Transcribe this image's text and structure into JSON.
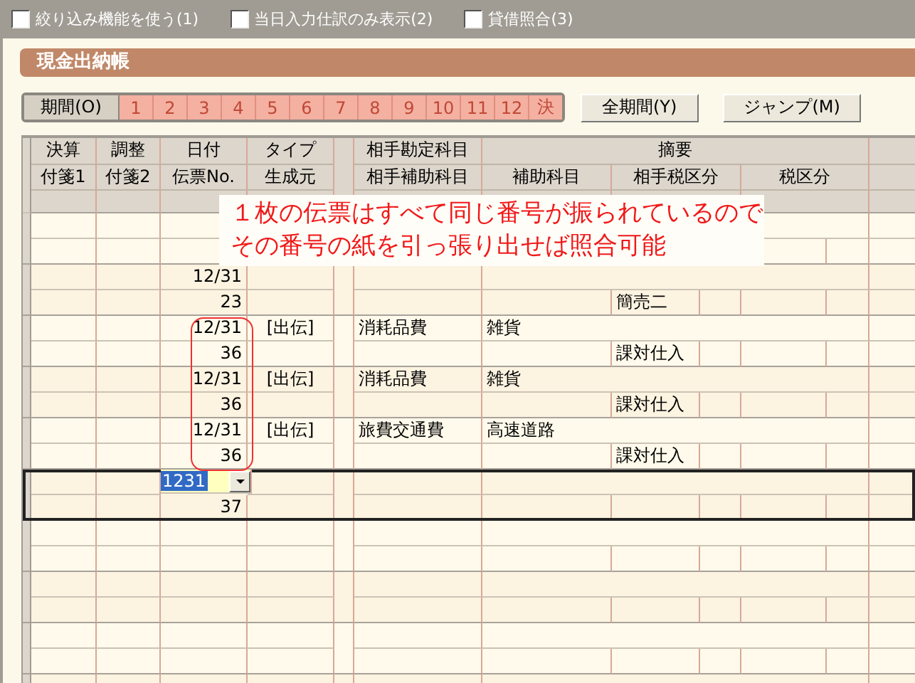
{
  "options": [
    {
      "label": "絞り込み機能を使う(1)",
      "checked": false
    },
    {
      "label": "当日入力仕訳のみ表示(2)",
      "checked": false
    },
    {
      "label": "貸借照合(3)",
      "checked": false
    }
  ],
  "ledger": {
    "title": "現金出納帳"
  },
  "period_bar": {
    "label": "期間(O)",
    "periods": [
      "1",
      "2",
      "3",
      "4",
      "5",
      "6",
      "7",
      "8",
      "9",
      "10",
      "11",
      "12",
      "決"
    ],
    "buttons": [
      "全期間(Y)",
      "ジャンプ(M)"
    ]
  },
  "table": {
    "header_top": [
      "決算",
      "調整",
      "日付",
      "タイプ",
      "相手勘定科目",
      "摘要"
    ],
    "header_bottom": [
      "付箋1",
      "付箋2",
      "伝票No.",
      "生成元",
      "相手補助科目",
      "補助科目",
      "相手税区分",
      "税区分"
    ],
    "entries": [
      {
        "kind": "entry",
        "selected": false
      },
      {
        "kind": "entry",
        "selected": false,
        "date": "12/31",
        "voucher_no": "23",
        "counter_tax": "簡売二"
      },
      {
        "kind": "entry",
        "selected": false,
        "date": "12/31",
        "type": "[出伝]",
        "account": "消耗品費",
        "memo": "雑貨",
        "voucher_no": "36",
        "counter_tax": "課対仕入"
      },
      {
        "kind": "entry",
        "selected": false,
        "date": "12/31",
        "type": "[出伝]",
        "account": "消耗品費",
        "memo": "雑貨",
        "voucher_no": "36",
        "counter_tax": "課対仕入"
      },
      {
        "kind": "entry",
        "selected": false,
        "date": "12/31",
        "type": "[出伝]",
        "account": "旅費交通費",
        "memo": "高速道路",
        "voucher_no": "36",
        "counter_tax": "課対仕入"
      },
      {
        "kind": "input",
        "selected": true,
        "date": "1231",
        "voucher_no": "37"
      }
    ]
  },
  "callout": {
    "lines": [
      "１枚の伝票はすべて同じ番号が振られているので",
      "その番号の紙を引っ張り出せば照合可能"
    ]
  }
}
